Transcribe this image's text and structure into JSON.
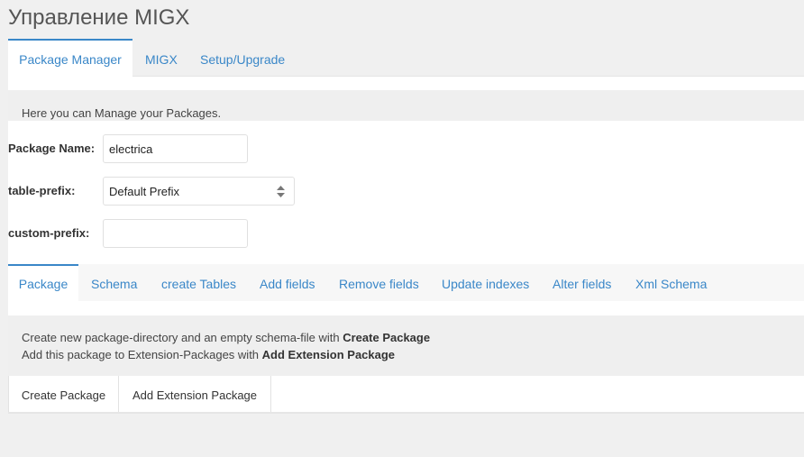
{
  "page": {
    "title": "Управление MIGX"
  },
  "top_tabs": [
    {
      "label": "Package Manager",
      "active": true
    },
    {
      "label": "MIGX",
      "active": false
    },
    {
      "label": "Setup/Upgrade",
      "active": false
    }
  ],
  "description": "Here you can Manage your Packages.",
  "form": {
    "package_name_label": "Package Name:",
    "package_name_value": "electrica",
    "table_prefix_label": "table-prefix:",
    "table_prefix_value": "Default Prefix",
    "custom_prefix_label": "custom-prefix:",
    "custom_prefix_value": ""
  },
  "sub_tabs": [
    {
      "label": "Package",
      "active": true
    },
    {
      "label": "Schema",
      "active": false
    },
    {
      "label": "create Tables",
      "active": false
    },
    {
      "label": "Add fields",
      "active": false
    },
    {
      "label": "Remove fields",
      "active": false
    },
    {
      "label": "Update indexes",
      "active": false
    },
    {
      "label": "Alter fields",
      "active": false
    },
    {
      "label": "Xml Schema",
      "active": false
    }
  ],
  "info": {
    "line1_text": "Create new package-directory and an empty schema-file with ",
    "line1_bold": "Create Package",
    "line2_text": "Add this package to Extension-Packages with ",
    "line2_bold": "Add Extension Package"
  },
  "actions": {
    "create_package": "Create Package",
    "add_extension_package": "Add Extension Package"
  },
  "colors": {
    "accent": "#3a87c8",
    "panel_bg": "#efefef"
  }
}
